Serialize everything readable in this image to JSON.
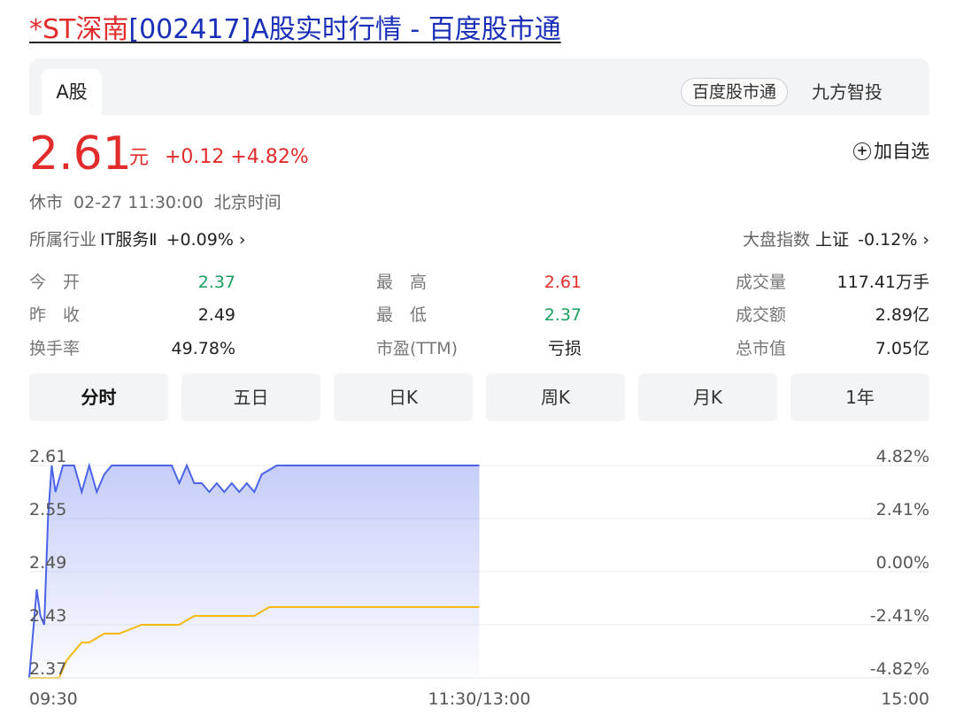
{
  "title": {
    "name": "*ST深南",
    "code": "[002417]",
    "suffix": "A股实时行情 - 百度股市通"
  },
  "tabs": {
    "active": "A股",
    "badge": "百度股市通",
    "other": "九方智投"
  },
  "quote": {
    "price": "2.61",
    "unit": "元",
    "change": "+0.12",
    "change_pct": "+4.82%",
    "watch_label": "加自选"
  },
  "status": {
    "state": "休市",
    "datetime": "02-27 11:30:00",
    "timezone": "北京时间"
  },
  "industry": {
    "label": "所属行业",
    "name": "IT服务Ⅱ",
    "change": "+0.09%"
  },
  "market": {
    "label": "大盘指数",
    "name": "上证",
    "change": "-0.12%"
  },
  "stats": {
    "open_label": "今　开",
    "open": "2.37",
    "prev_label": "昨　收",
    "prev": "2.49",
    "turnover_label": "换手率",
    "turnover": "49.78%",
    "high_label": "最　高",
    "high": "2.61",
    "low_label": "最　低",
    "low": "2.37",
    "pe_label": "市盈(TTM)",
    "pe": "亏损",
    "volume_label": "成交量",
    "volume": "117.41万手",
    "amount_label": "成交额",
    "amount": "2.89亿",
    "mcap_label": "总市值",
    "mcap": "7.05亿"
  },
  "periods": [
    "分时",
    "五日",
    "日K",
    "周K",
    "月K",
    "1年"
  ],
  "colors": {
    "up": "#e22b2b",
    "down": "#19a15f",
    "price_line": "#4b63e8",
    "avg_line": "#f5b912"
  },
  "chart_data": {
    "type": "line",
    "ylim": [
      2.37,
      2.61
    ],
    "y_ticks": [
      "2.61",
      "2.55",
      "2.49",
      "2.43",
      "2.37"
    ],
    "y_ticks_right": [
      "4.82%",
      "2.41%",
      "0.00%",
      "-2.41%",
      "-4.82%"
    ],
    "x_ticks": [
      "09:30",
      "11:30/13:00",
      "15:00"
    ],
    "x_range_minutes": [
      0,
      240
    ],
    "series": [
      {
        "key": "price",
        "x": [
          0,
          2,
          3,
          4,
          5,
          6,
          7,
          9,
          10,
          12,
          14,
          16,
          18,
          20,
          22,
          24,
          26,
          28,
          30,
          32,
          34,
          36,
          38,
          40,
          42,
          44,
          46,
          48,
          50,
          52,
          54,
          56,
          58,
          60,
          62,
          66,
          80,
          90,
          120
        ],
        "values": [
          2.37,
          2.47,
          2.44,
          2.43,
          2.55,
          2.61,
          2.58,
          2.61,
          2.61,
          2.61,
          2.58,
          2.61,
          2.58,
          2.6,
          2.61,
          2.61,
          2.61,
          2.61,
          2.61,
          2.61,
          2.61,
          2.61,
          2.61,
          2.59,
          2.61,
          2.59,
          2.59,
          2.58,
          2.59,
          2.58,
          2.59,
          2.58,
          2.59,
          2.58,
          2.6,
          2.61,
          2.61,
          2.61,
          2.61
        ]
      },
      {
        "key": "average",
        "x": [
          0,
          8,
          10,
          14,
          16,
          20,
          24,
          30,
          34,
          40,
          44,
          50,
          52,
          60,
          64,
          120
        ],
        "values": [
          2.37,
          2.37,
          2.39,
          2.41,
          2.41,
          2.42,
          2.42,
          2.43,
          2.43,
          2.43,
          2.44,
          2.44,
          2.44,
          2.44,
          2.45,
          2.45
        ]
      }
    ]
  }
}
